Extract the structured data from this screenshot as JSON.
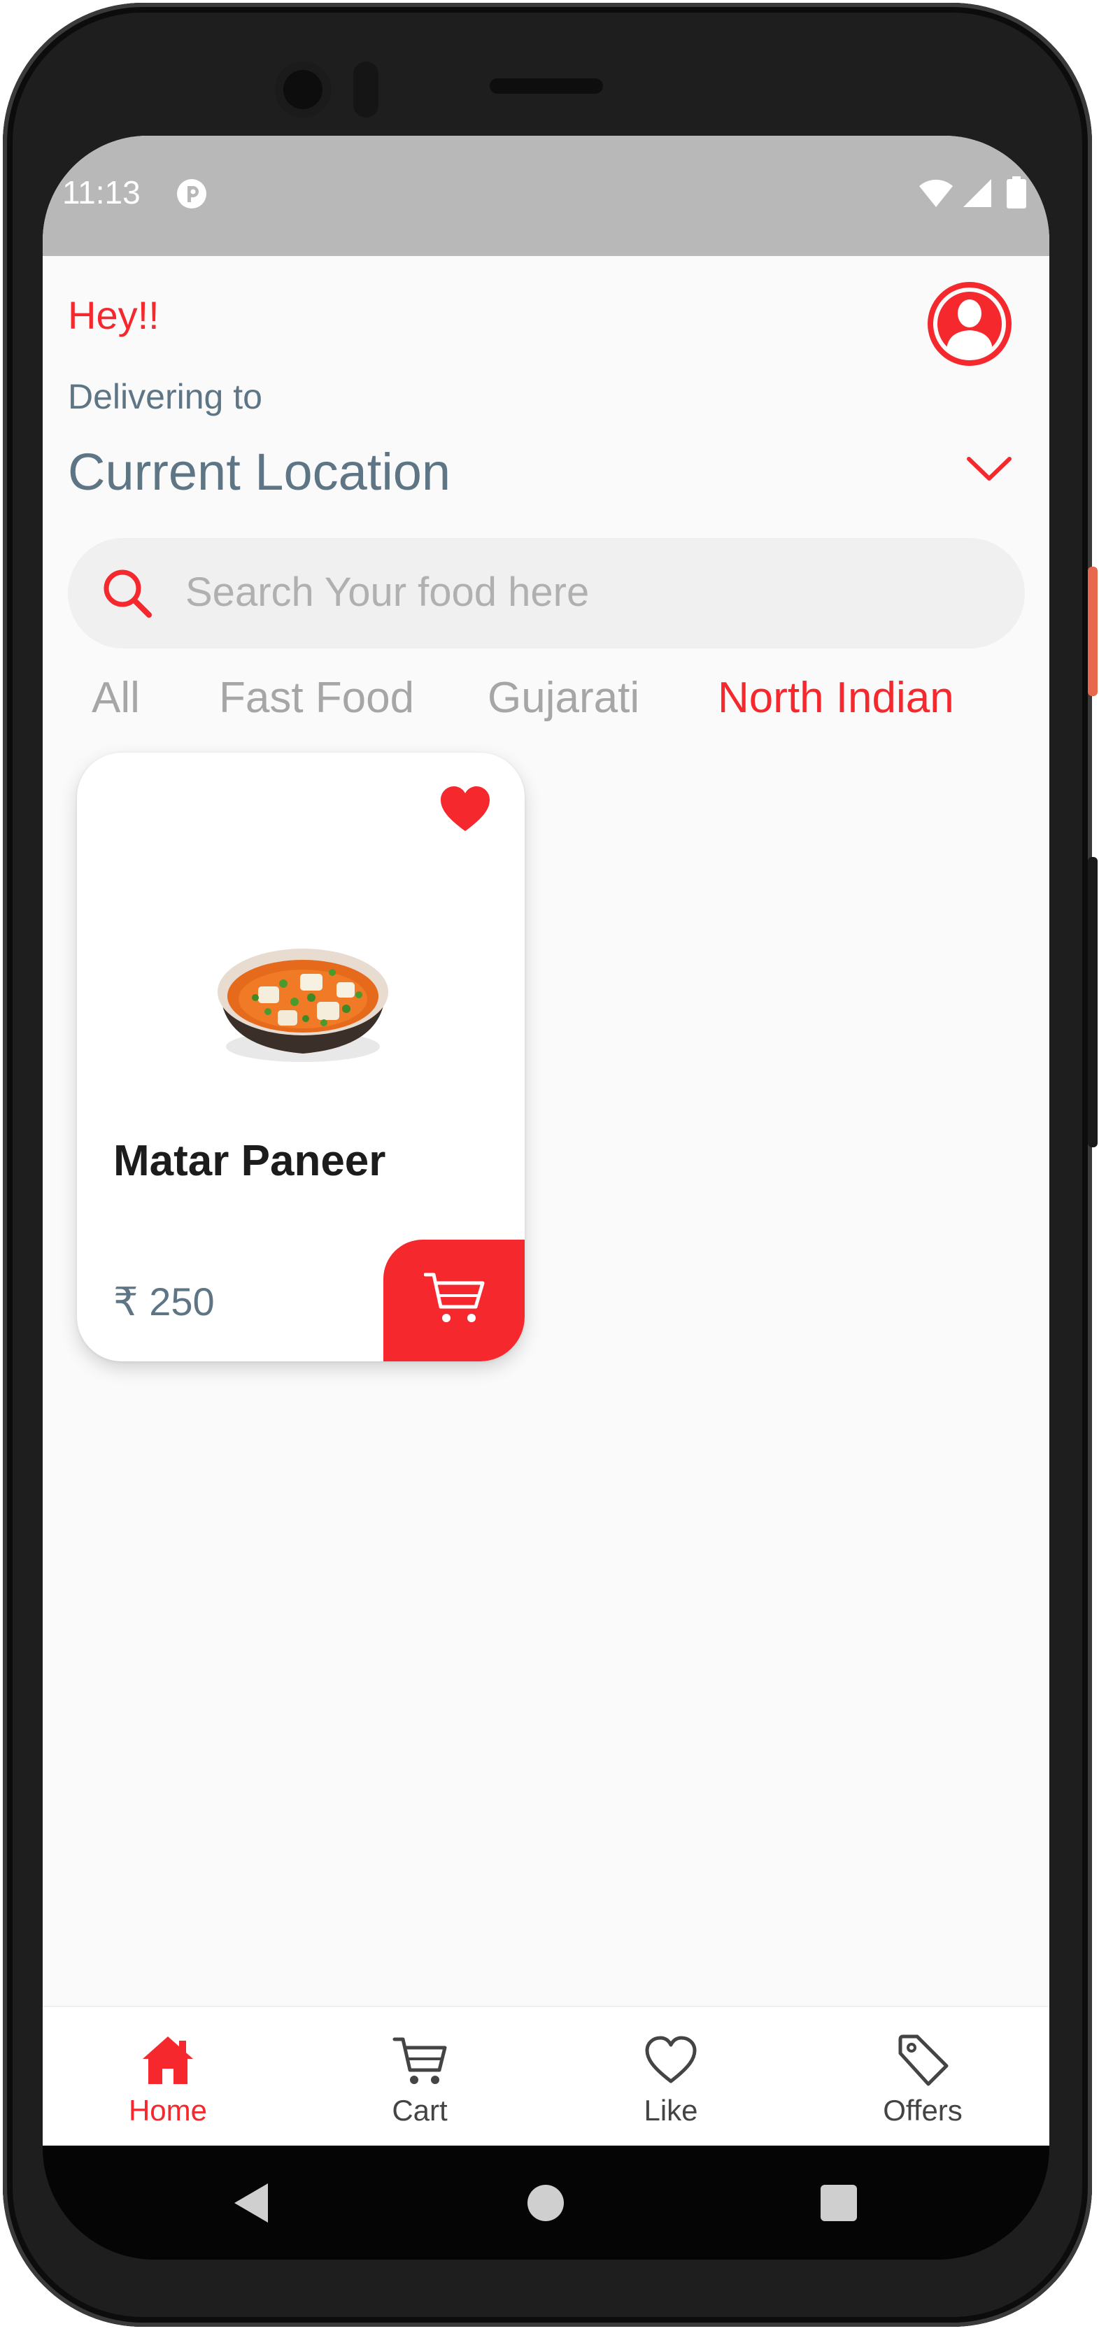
{
  "status_bar": {
    "time": "11:13",
    "icons": [
      "app-notification-icon",
      "wifi-icon",
      "signal-icon",
      "battery-icon"
    ]
  },
  "header": {
    "greeting": "Hey!!",
    "delivering_label": "Delivering to",
    "location": "Current Location",
    "profile_icon": "user-profile-icon",
    "dropdown_icon": "chevron-down-icon"
  },
  "search": {
    "placeholder": "Search Your food here",
    "icon": "search-icon"
  },
  "categories": {
    "tabs": [
      {
        "label": "All",
        "active": false
      },
      {
        "label": "Fast Food",
        "active": false
      },
      {
        "label": "Gujarati",
        "active": false
      },
      {
        "label": "North Indian",
        "active": true
      }
    ]
  },
  "food_items": [
    {
      "name": "Matar Paneer",
      "price": "₹ 250",
      "favorite": true,
      "image": "matar-paneer-bowl"
    }
  ],
  "bottom_nav": {
    "items": [
      {
        "label": "Home",
        "icon": "home-icon",
        "active": true
      },
      {
        "label": "Cart",
        "icon": "cart-icon",
        "active": false
      },
      {
        "label": "Like",
        "icon": "heart-icon",
        "active": false
      },
      {
        "label": "Offers",
        "icon": "tag-icon",
        "active": false
      }
    ]
  },
  "system_nav": {
    "icons": [
      "back-icon",
      "home-circle-icon",
      "recents-icon"
    ]
  },
  "colors": {
    "accent": "#f5282d",
    "muted_text": "#5e7585",
    "inactive_tab": "#a6a6a6",
    "background": "#fafafa",
    "status_bar": "#b8b8b8"
  }
}
